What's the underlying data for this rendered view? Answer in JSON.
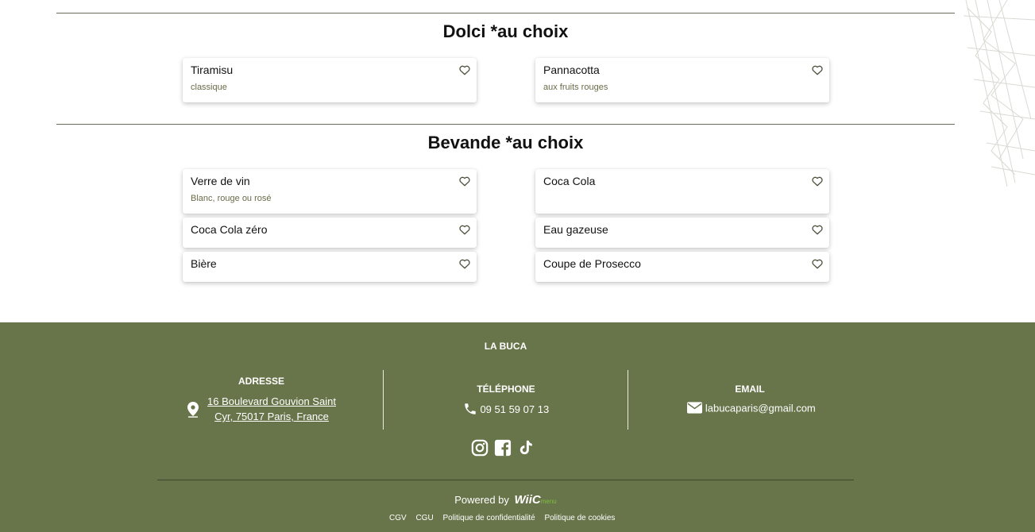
{
  "sections": [
    {
      "title": "Dolci *au choix",
      "items": [
        {
          "name": "Tiramisu",
          "desc": "classique"
        },
        {
          "name": "Pannacotta",
          "desc": "aux fruits rouges"
        }
      ]
    },
    {
      "title": "Bevande *au choix",
      "items": [
        {
          "name": "Verre de vin",
          "desc": "Blanc, rouge ou rosé"
        },
        {
          "name": "Coca Cola",
          "desc": ""
        },
        {
          "name": "Coca Cola zéro",
          "desc": ""
        },
        {
          "name": "Eau gazeuse",
          "desc": ""
        },
        {
          "name": "Bière",
          "desc": ""
        },
        {
          "name": "Coupe de Prosecco",
          "desc": ""
        }
      ]
    }
  ],
  "footer": {
    "brand": "LA BUCA",
    "address": {
      "title": "ADRESSE",
      "line1": "16 Boulevard Gouvion Saint",
      "line2": "Cyr, 75017 Paris, France",
      "icon": "map-pin-icon"
    },
    "phone": {
      "title": "TÉLÉPHONE",
      "value": "09 51 59 07 13",
      "icon": "phone-icon"
    },
    "email": {
      "title": "EMAIL",
      "value": "labucaparis@gmail.com",
      "icon": "envelope-icon"
    },
    "social": [
      "instagram-icon",
      "facebook-icon",
      "tiktok-icon"
    ],
    "powered_by": "Powered by",
    "powered_brand": "WiiC",
    "powered_suffix": "menu",
    "legal": [
      "CGV",
      "CGU",
      "Politique de confidentialité",
      "Politique de cookies"
    ]
  },
  "colors": {
    "footer_bg": "#68744a",
    "accent_text": "#6b6b4a"
  },
  "icons": {
    "favorite": "heart-outline-icon"
  }
}
